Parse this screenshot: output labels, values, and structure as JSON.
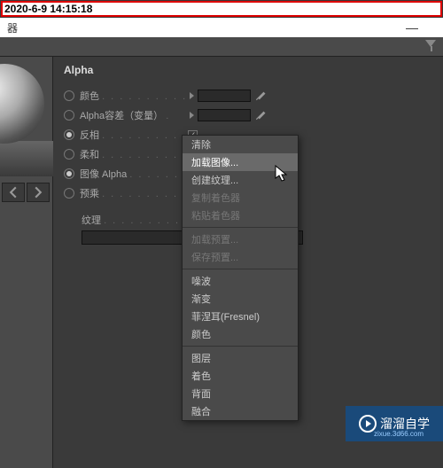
{
  "timestamp": "2020-6-9 14:15:18",
  "window": {
    "title_suffix": "器"
  },
  "panel": {
    "title": "Alpha",
    "props": {
      "color": {
        "label": "颜色",
        "on": false
      },
      "alpha_tol": {
        "label": "Alpha容差（变量）",
        "on": false
      },
      "invert": {
        "label": "反相",
        "on": true,
        "checked": true
      },
      "soft": {
        "label": "柔和",
        "on": false,
        "checked": false
      },
      "image_alpha": {
        "label": "图像 Alpha",
        "on": true,
        "checked": false
      },
      "premul": {
        "label": "预乘",
        "on": false,
        "checked": false
      }
    },
    "texture_label": "纹理"
  },
  "menu": {
    "clear": "清除",
    "load_image": "加载图像...",
    "create_texture": "创建纹理...",
    "copy_shader": "复制着色器",
    "paste_shader": "粘贴着色器",
    "load_preset": "加载预置...",
    "save_preset": "保存预置...",
    "noise": "噪波",
    "gradient": "渐变",
    "fresnel": "菲涅耳(Fresnel)",
    "color_item": "颜色",
    "layer": "图层",
    "shade": "着色",
    "backface": "背面",
    "blend": "融合"
  },
  "watermark": {
    "text": "溜溜自学",
    "sub": "zixue.3d66.com"
  }
}
